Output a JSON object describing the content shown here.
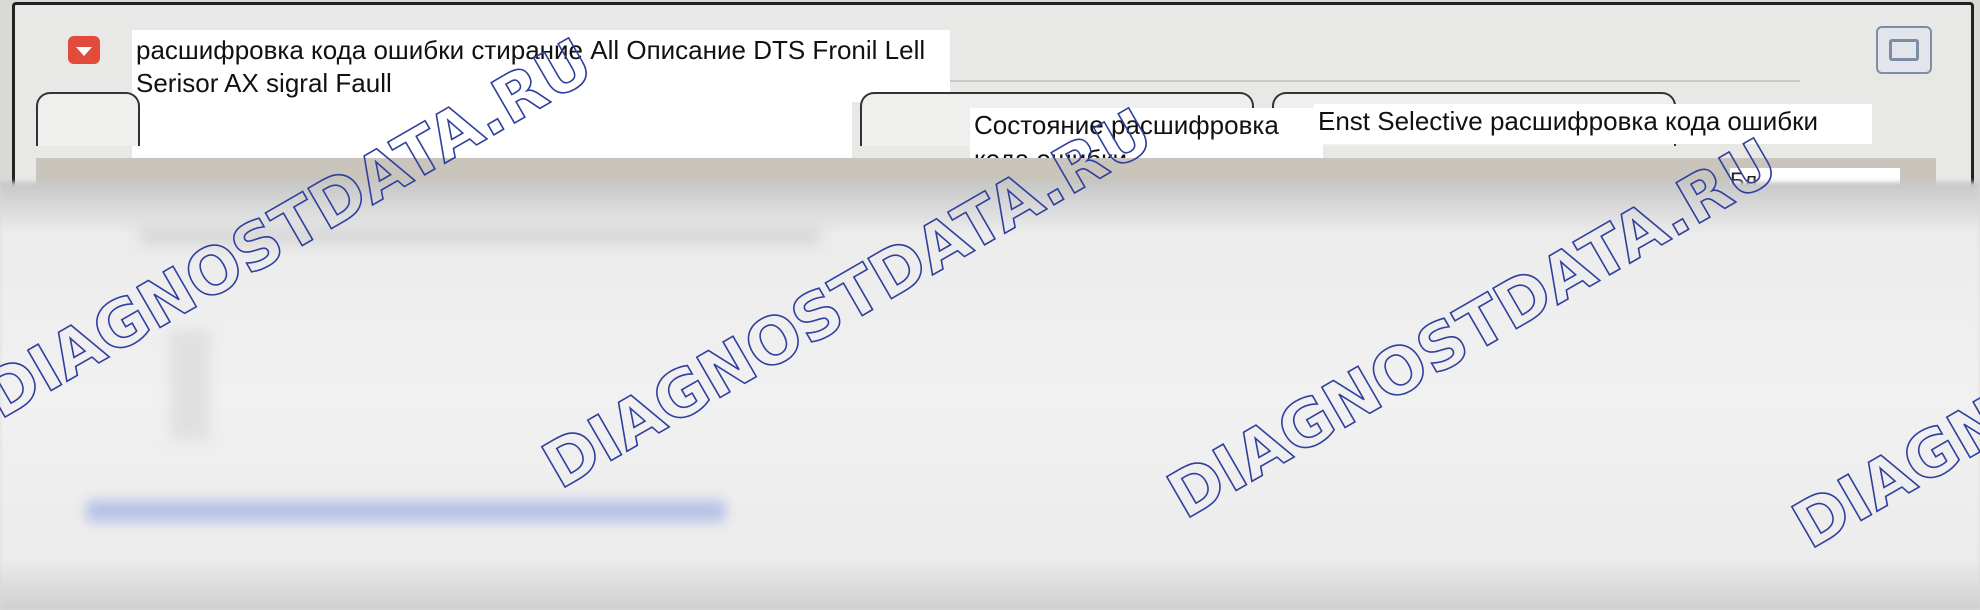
{
  "window": {
    "title": "расшифровка кода ошибки стирание All Описание DTS Fronil Lell Serisor AX sigral Faull",
    "maximize_icon": "window-restore-icon",
    "app_icon": "dropdown-arrow-icon"
  },
  "tabs": [
    {
      "label": ""
    },
    {
      "label": "Состояние расшифровка кода ошибки"
    },
    {
      "label": "Enst Selective расшифровка кода ошибки"
    }
  ],
  "toolbar": {
    "partial_label": "Бл..."
  },
  "watermark": {
    "text": "DIAGNOSTDATA.RU",
    "color": "#2e3f9e"
  }
}
